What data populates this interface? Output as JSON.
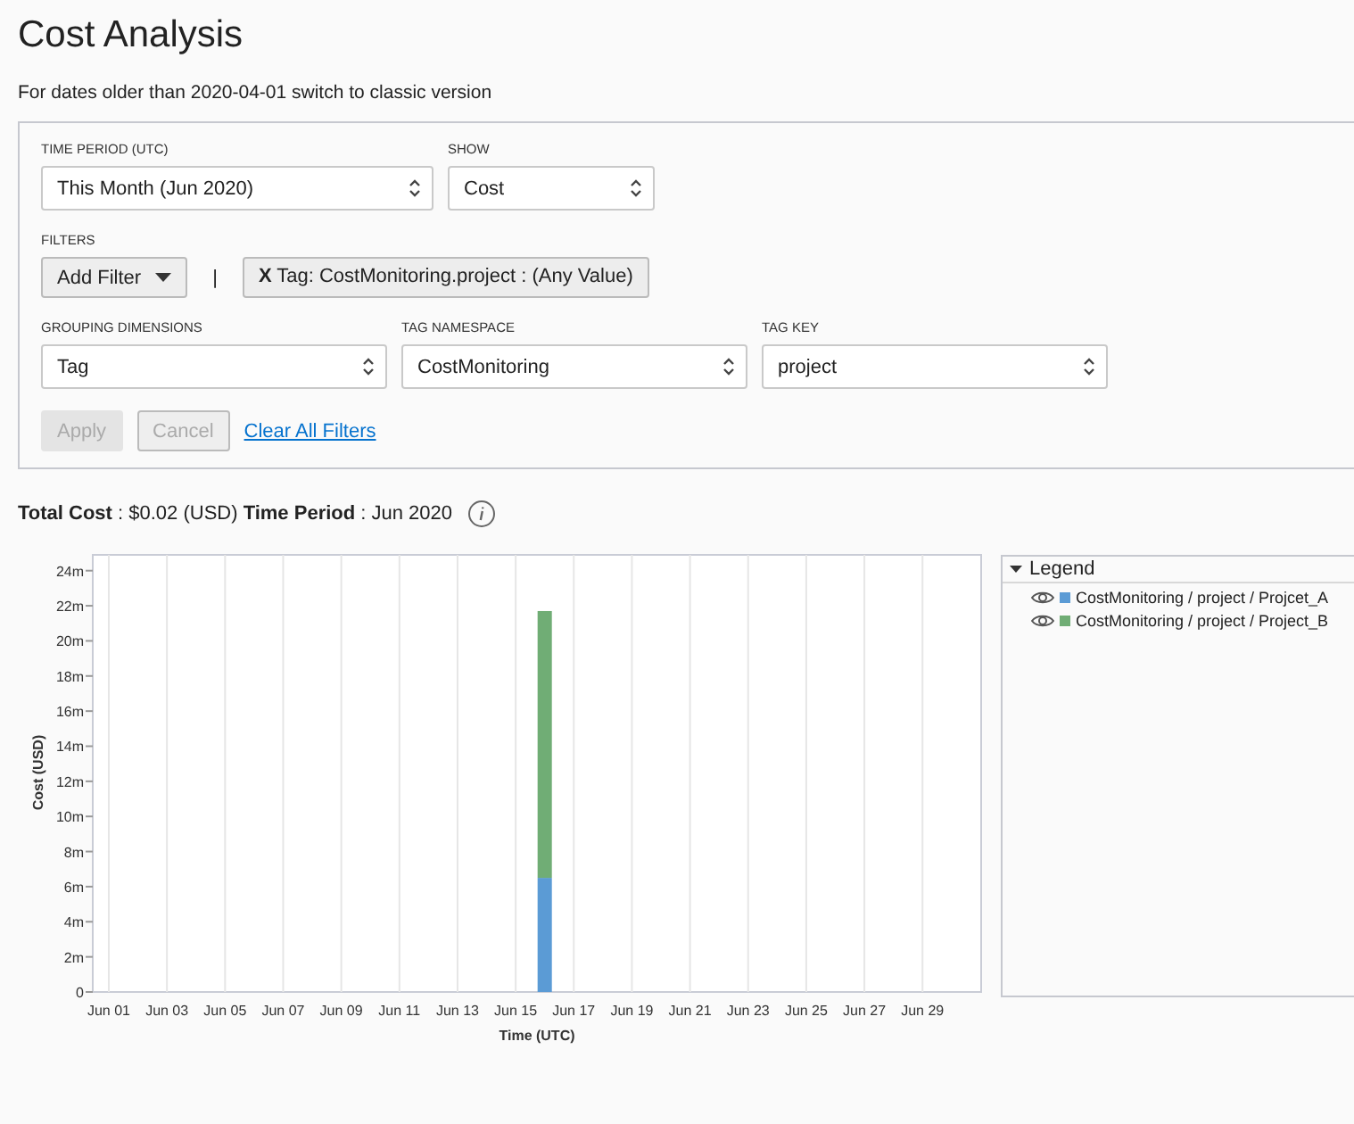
{
  "title": "Cost Analysis",
  "notice": "For dates older than 2020-04-01 switch to classic version",
  "filters_panel": {
    "time_period": {
      "label": "TIME PERIOD (UTC)",
      "value": "This Month (Jun 2020)"
    },
    "show": {
      "label": "SHOW",
      "value": "Cost"
    },
    "filters": {
      "label": "FILTERS",
      "add_button": "Add Filter",
      "separator": "|",
      "chips": [
        "**X** Tag: CostMonitoring.project : (Any Value)"
      ]
    },
    "grouping": {
      "label": "GROUPING DIMENSIONS",
      "value": "Tag"
    },
    "tag_namespace": {
      "label": "TAG NAMESPACE",
      "value": "CostMonitoring"
    },
    "tag_key": {
      "label": "TAG KEY",
      "value": "project"
    },
    "buttons": [
      {
        "label": "Apply",
        "kind": "primary",
        "disabled": true
      },
      {
        "label": "Cancel",
        "kind": "secondary",
        "disabled": true
      },
      {
        "label": "Clear All Filters",
        "kind": "link",
        "disabled": false
      }
    ]
  },
  "summary": "**Total Cost** : $0.02 (USD) **Time Period** : Jun 2020",
  "chart": {
    "chart_data": {
      "type": "bar",
      "stacked": true,
      "xlabel": "Time (UTC)",
      "ylabel": "Cost (USD)",
      "categories": [
        "Jun 01",
        null,
        "Jun 03",
        null,
        "Jun 05",
        null,
        "Jun 07",
        null,
        "Jun 09",
        null,
        "Jun 11",
        null,
        "Jun 13",
        null,
        "Jun 15",
        null,
        "Jun 17",
        null,
        "Jun 19",
        null,
        "Jun 21",
        null,
        "Jun 23",
        null,
        "Jun 25",
        null,
        "Jun 27",
        null,
        "Jun 29",
        null
      ],
      "grid": true,
      "series": [
        {
          "name": "CostMonitoring / project / Projcet_A",
          "color": "#5b9bd5",
          "values": [
            null,
            null,
            null,
            null,
            null,
            null,
            null,
            null,
            null,
            null,
            null,
            null,
            null,
            null,
            null,
            6.5,
            null,
            null,
            null,
            null,
            null,
            null,
            null,
            null,
            null,
            null,
            null,
            null,
            null,
            null
          ]
        },
        {
          "name": "CostMonitoring / project / Project_B",
          "color": "#70ad75",
          "values": [
            null,
            null,
            null,
            null,
            null,
            null,
            null,
            null,
            null,
            null,
            null,
            null,
            null,
            null,
            null,
            15.2,
            null,
            null,
            null,
            null,
            null,
            null,
            null,
            null,
            null,
            null,
            null,
            null,
            null,
            null
          ]
        }
      ],
      "ylim": [
        0,
        24.9
      ],
      "yticks": [
        {
          "value": 0,
          "label": "0"
        },
        {
          "value": 2,
          "label": "2m"
        },
        {
          "value": 4,
          "label": "4m"
        },
        {
          "value": 6,
          "label": "6m"
        },
        {
          "value": 8,
          "label": "8m"
        },
        {
          "value": 10,
          "label": "10m"
        },
        {
          "value": 12,
          "label": "12m"
        },
        {
          "value": 14,
          "label": "14m"
        },
        {
          "value": 16,
          "label": "16m"
        },
        {
          "value": 18,
          "label": "18m"
        },
        {
          "value": 20,
          "label": "20m"
        },
        {
          "value": 22,
          "label": "22m"
        },
        {
          "value": 24,
          "label": "24m"
        }
      ]
    }
  },
  "legend": {
    "title": "Legend",
    "expanded": true
  }
}
